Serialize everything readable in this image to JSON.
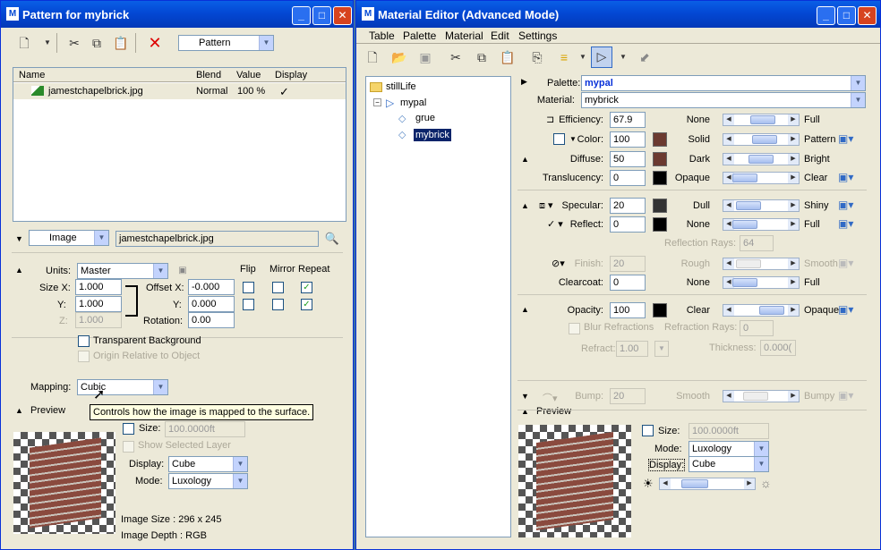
{
  "left": {
    "title": "Pattern for mybrick",
    "toolbar": {
      "pattern_dd": "Pattern"
    },
    "table": {
      "headers": [
        "Name",
        "Blend",
        "Value",
        "Display"
      ],
      "rows": [
        {
          "name": "jamestchapelbrick.jpg",
          "blend": "Normal",
          "value": "100 %",
          "display": "✓"
        }
      ]
    },
    "image": {
      "type": "Image",
      "file": "jamestchapelbrick.jpg"
    },
    "units_label": "Units:",
    "units_value": "Master",
    "flip": "Flip",
    "mirror": "Mirror",
    "repeat": "Repeat",
    "sizex_label": "Size X:",
    "sizex": "1.000",
    "y_label": "Y:",
    "sizey": "1.000",
    "z_label": "Z:",
    "sizez": "1.000",
    "offx_label": "Offset X:",
    "offx": "-0.000",
    "offy_label": "Y:",
    "offy": "0.000",
    "rot_label": "Rotation:",
    "rot": "0.00",
    "transparent_bg": "Transparent Background",
    "origin_rel": "Origin Relative to Object",
    "mapping_label": "Mapping:",
    "mapping_value": "Cubic",
    "tooltip": "Controls how the image is mapped to the surface.",
    "preview": "Preview",
    "size_label": "Size:",
    "size_value": "100.0000ft",
    "show_sel": "Show Selected Layer",
    "display_label": "Display:",
    "display_value": "Cube",
    "mode_label": "Mode:",
    "mode_value": "Luxology",
    "img_size": "Image Size : 296 x 245",
    "img_depth": "Image Depth : RGB"
  },
  "right": {
    "title": "Material Editor (Advanced Mode)",
    "menu": [
      "Table",
      "Palette",
      "Material",
      "Edit",
      "Settings"
    ],
    "tree": {
      "root": "stillLife",
      "pal": "mypal",
      "items": [
        "grue",
        "mybrick"
      ]
    },
    "palette_label": "Palette:",
    "palette_value": "mypal",
    "material_label": "Material:",
    "material_value": "mybrick",
    "rows": [
      {
        "label": "Efficiency:",
        "value": "67.9",
        "left": "None",
        "right": "Full"
      },
      {
        "label": "Color:",
        "value": "100",
        "left": "Solid",
        "right": "Pattern"
      },
      {
        "label": "Diffuse:",
        "value": "50",
        "left": "Dark",
        "right": "Bright"
      },
      {
        "label": "Translucency:",
        "value": "0",
        "left": "Opaque",
        "right": "Clear"
      },
      {
        "label": "Specular:",
        "value": "20",
        "left": "Dull",
        "right": "Shiny"
      },
      {
        "label": "Reflect:",
        "value": "0",
        "left": "None",
        "right": "Full"
      },
      {
        "label": "Finish:",
        "value": "20",
        "left": "Rough",
        "right": "Smooth"
      },
      {
        "label": "Clearcoat:",
        "value": "0",
        "left": "None",
        "right": "Full"
      },
      {
        "label": "Opacity:",
        "value": "100",
        "left": "Clear",
        "right": "Opaque"
      },
      {
        "label": "Bump:",
        "value": "20",
        "left": "Smooth",
        "right": "Bumpy"
      }
    ],
    "refl_rays_label": "Reflection Rays:",
    "refl_rays": "64",
    "blur_refr": "Blur Refractions",
    "refr_rays_label": "Refraction Rays:",
    "refr_rays": "0",
    "refract_label": "Refract:",
    "refract": "1.00",
    "thick_label": "Thickness:",
    "thick": "0.000(",
    "preview": "Preview",
    "size_label": "Size:",
    "size_value": "100.0000ft",
    "mode_label": "Mode:",
    "mode_value": "Luxology",
    "display_label": "Display:",
    "display_value": "Cube"
  }
}
